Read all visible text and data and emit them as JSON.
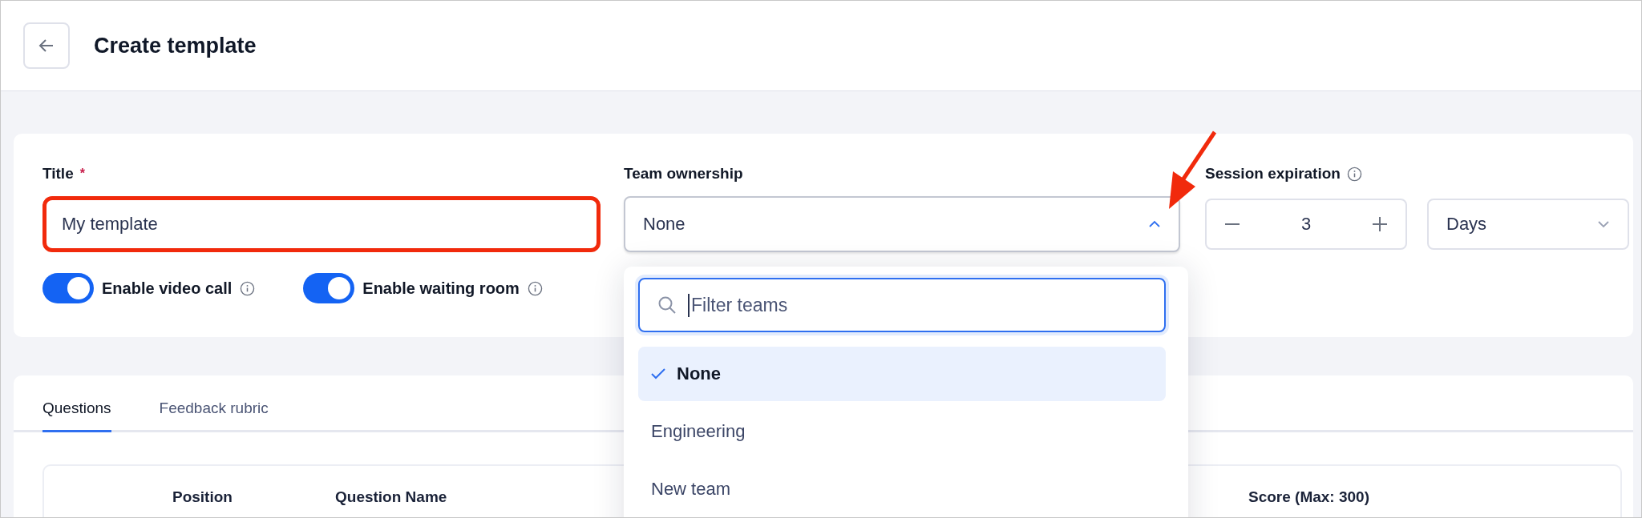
{
  "header": {
    "title": "Create template"
  },
  "form": {
    "title_field": {
      "label": "Title",
      "required_mark": "*",
      "value": "My template",
      "highlighted": true
    },
    "team_field": {
      "label": "Team ownership",
      "value": "None",
      "expanded": true,
      "dropdown": {
        "search_placeholder": "Filter teams",
        "options": [
          {
            "label": "None",
            "selected": true
          },
          {
            "label": "Engineering",
            "selected": false
          },
          {
            "label": "New team",
            "selected": false
          }
        ]
      }
    },
    "session_expiration": {
      "label": "Session expiration",
      "value": "3",
      "unit": "Days",
      "unit_expanded": false
    },
    "toggles": [
      {
        "label": "Enable video call",
        "on": true
      },
      {
        "label": "Enable waiting room",
        "on": true
      }
    ]
  },
  "tabs": [
    {
      "label": "Questions",
      "selected": true
    },
    {
      "label": "Feedback rubric",
      "selected": false
    }
  ],
  "table": {
    "columns": [
      "Position",
      "Question Name",
      "Score (Max: 300)"
    ]
  },
  "annotation": {
    "arrow": true
  }
}
